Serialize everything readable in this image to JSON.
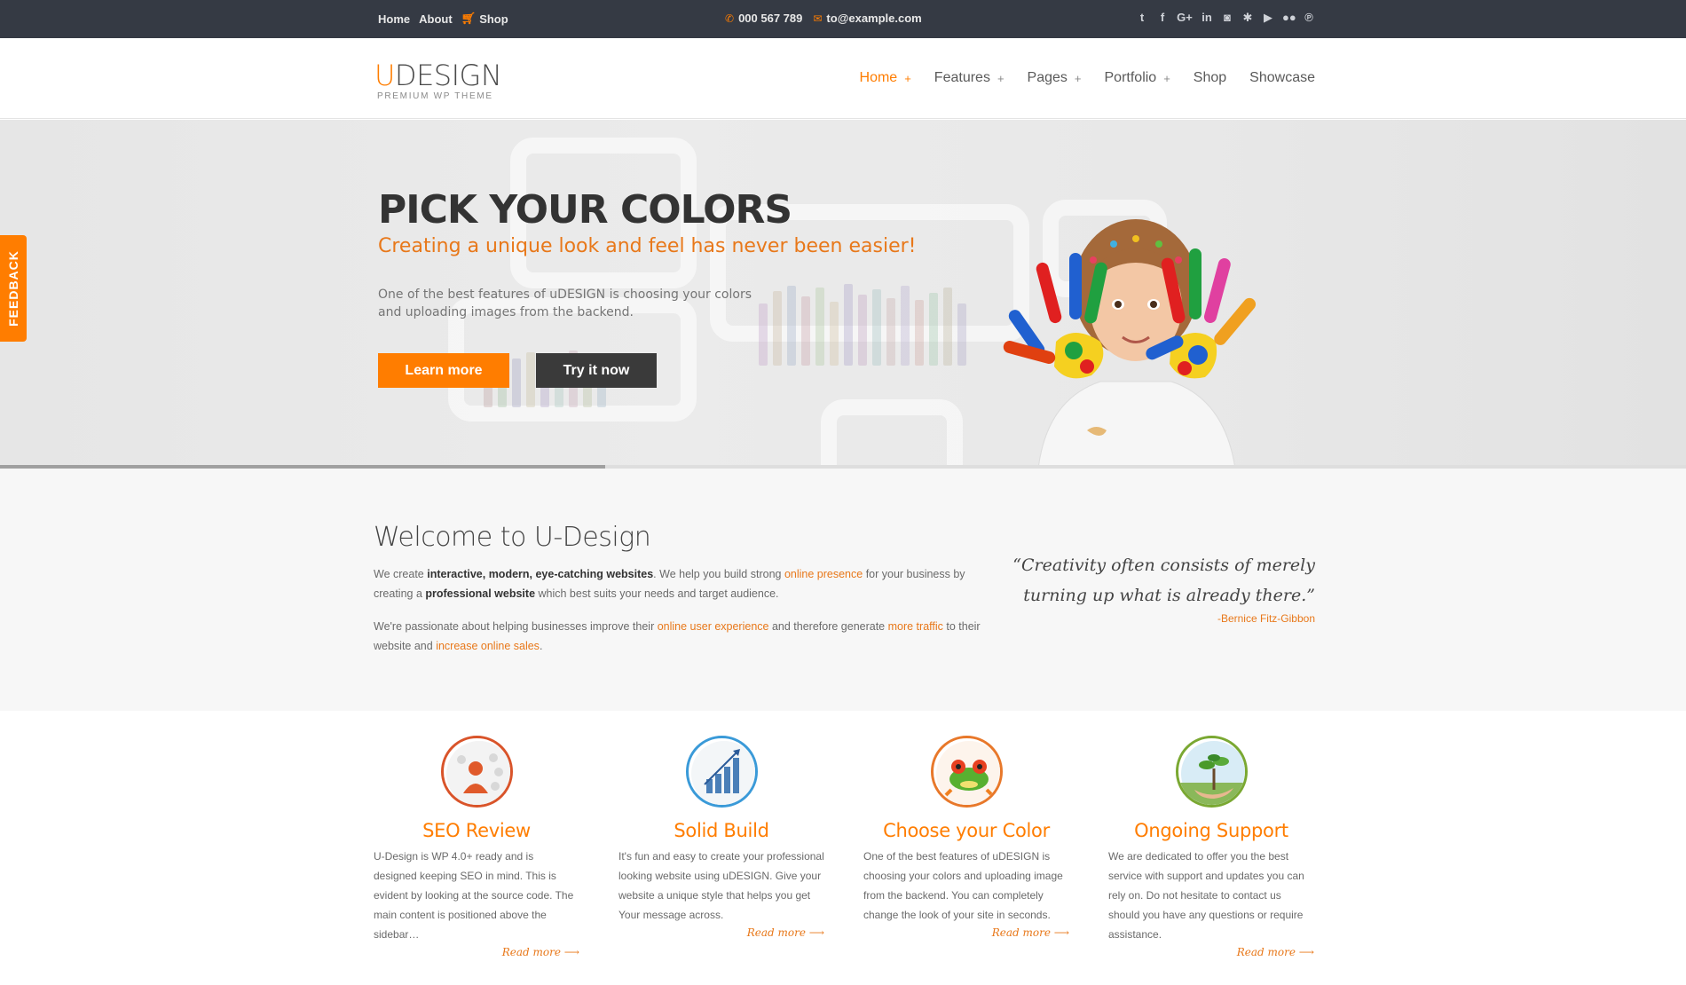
{
  "topbar": {
    "nav": [
      {
        "label": "Home",
        "icon": ""
      },
      {
        "label": "About",
        "icon": ""
      },
      {
        "label": "Shop",
        "icon": "cart-icon"
      }
    ],
    "phone": "000 567 789",
    "email": "to@example.com",
    "social": [
      "twitter-icon",
      "facebook-icon",
      "google-plus-icon",
      "linkedin-icon",
      "instagram-icon",
      "yelp-icon",
      "youtube-icon",
      "flickr-icon",
      "pinterest-icon"
    ]
  },
  "logo": {
    "first": "U",
    "rest": "DESIGN",
    "tagline": "PREMIUM WP THEME"
  },
  "nav": [
    {
      "label": "Home",
      "plus": "+",
      "active": true
    },
    {
      "label": "Features",
      "plus": "+"
    },
    {
      "label": "Pages",
      "plus": "+"
    },
    {
      "label": "Portfolio",
      "plus": "+"
    },
    {
      "label": "Shop",
      "plus": ""
    },
    {
      "label": "Showcase",
      "plus": ""
    }
  ],
  "hero": {
    "title": "PICK YOUR COLORS",
    "subtitle": "Creating a unique look and feel has never been easier!",
    "text": "One of the best features of uDESIGN is choosing your colors and uploading images from the backend.",
    "learn_more": "Learn more",
    "try_it": "Try it now"
  },
  "feedback": "FEEDBACK",
  "welcome": {
    "title": "Welcome to U-Design",
    "p1": {
      "a": "We create ",
      "b": "interactive, modern, eye-catching websites",
      "c": ". We help you build strong ",
      "d": "online presence",
      "e": " for your business by creating a ",
      "f": "professional website",
      "g": " which best suits your needs and target audience."
    },
    "p2": {
      "a": "We're passionate about helping businesses improve their ",
      "b": "online user experience",
      "c": " and therefore generate ",
      "d": "more traffic",
      "e": " to their website and ",
      "f": "increase online sales",
      "g": "."
    },
    "quote": "“Creativity often consists of merely turning up what is already there.”",
    "author": "-Bernice Fitz-Gibbon"
  },
  "features": [
    {
      "icon": "seo-review-icon",
      "title": "SEO Review",
      "text": "U-Design is WP 4.0+ ready and is designed keeping SEO in mind. This is evident by looking at the source code. The main content is positioned above the sidebar…",
      "more": "Read more ⟶"
    },
    {
      "icon": "bar-chart-icon",
      "title": "Solid Build",
      "text": "It's fun and easy to create your professional looking website using uDESIGN. Give your website a unique style that helps you get Your message across.",
      "more": "Read more ⟶"
    },
    {
      "icon": "frog-icon",
      "title": "Choose your Color",
      "text": "One of the best features of uDESIGN is choosing your colors and uploading image from the backend. You can completely change the look of your site in seconds.",
      "more": "Read more ⟶"
    },
    {
      "icon": "plant-hand-icon",
      "title": "Ongoing Support",
      "text": "We are dedicated to offer you the best service with support and updates you can rely on. Do not hesitate to contact us should you have any questions or require assistance.",
      "more": "Read more ⟶"
    }
  ],
  "colors": {
    "accent": "#ff7d00",
    "topbar": "#353a44",
    "dark_button": "#3a3a3a"
  }
}
